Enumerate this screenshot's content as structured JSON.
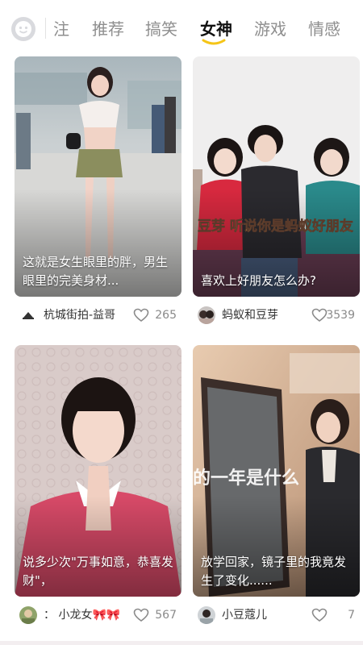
{
  "top_tabs": {
    "items": [
      {
        "label": "注",
        "active": false
      },
      {
        "label": "推荐",
        "active": false
      },
      {
        "label": "搞笑",
        "active": false
      },
      {
        "label": "女神",
        "active": true
      },
      {
        "label": "游戏",
        "active": false
      },
      {
        "label": "情感",
        "active": false
      }
    ],
    "accent_color": "#f5c518"
  },
  "feed": [
    {
      "caption": "这就是女生眼里的胖，男生眼里的完美身材...",
      "author": "杭城街拍-益哥",
      "likes": "265"
    },
    {
      "caption": "喜欢上好朋友怎么办?",
      "overlay_text": "豆芽 听说你是蚂蚁好朋友",
      "author": "蚂蚁和豆芽",
      "likes": "3539"
    },
    {
      "caption": "说多少次\"万事如意，恭喜发财\"，",
      "author": "：  小龙女🎀🎀",
      "likes": "567"
    },
    {
      "caption": "放学回家，镜子里的我竟发生了变化......",
      "overlay_text": "的一年是什么",
      "author": "小豆蔻儿",
      "likes": "7"
    }
  ]
}
